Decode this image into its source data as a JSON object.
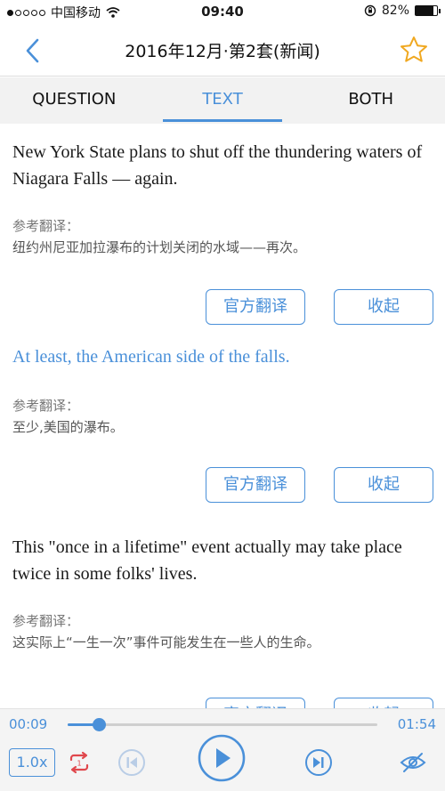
{
  "status_bar": {
    "carrier": "中国移动",
    "time": "09:40",
    "battery_percent": "82%",
    "battery_level": 0.82
  },
  "nav": {
    "title": "2016年12月·第2套(新闻)",
    "back_icon": "chevron-left-icon",
    "favorite_icon": "star-outline-icon"
  },
  "tabs": [
    {
      "label": "QUESTION",
      "active": false
    },
    {
      "label": "TEXT",
      "active": true
    },
    {
      "label": "BOTH",
      "active": false
    }
  ],
  "entries": [
    {
      "sentence": "New York State plans to shut off the thundering waters of Niagara Falls — again.",
      "highlighted": false,
      "translation_label": "参考翻译：",
      "translation": "纽约州尼亚加拉瀑布的计划关闭的水域——再次。",
      "official_button": "官方翻译",
      "collapse_button": "收起"
    },
    {
      "sentence": "At least, the American side of the falls.",
      "highlighted": true,
      "translation_label": "参考翻译：",
      "translation": "至少,美国的瀑布。",
      "official_button": "官方翻译",
      "collapse_button": "收起"
    },
    {
      "sentence": "This \"once in a lifetime\" event actually may take place twice in some folks' lives.",
      "highlighted": false,
      "translation_label": "参考翻译：",
      "translation": "这实际上“一生一次”事件可能发生在一些人的生命。",
      "official_button": "官方翻译",
      "collapse_button": "收起"
    }
  ],
  "player": {
    "current_time": "00:09",
    "total_time": "01:54",
    "progress": 0.1,
    "speed": "1.0x",
    "icons": [
      "repeat-icon",
      "previous-icon",
      "play-icon",
      "next-icon",
      "hide-text-icon"
    ],
    "accent_color": "#4a90d9"
  }
}
